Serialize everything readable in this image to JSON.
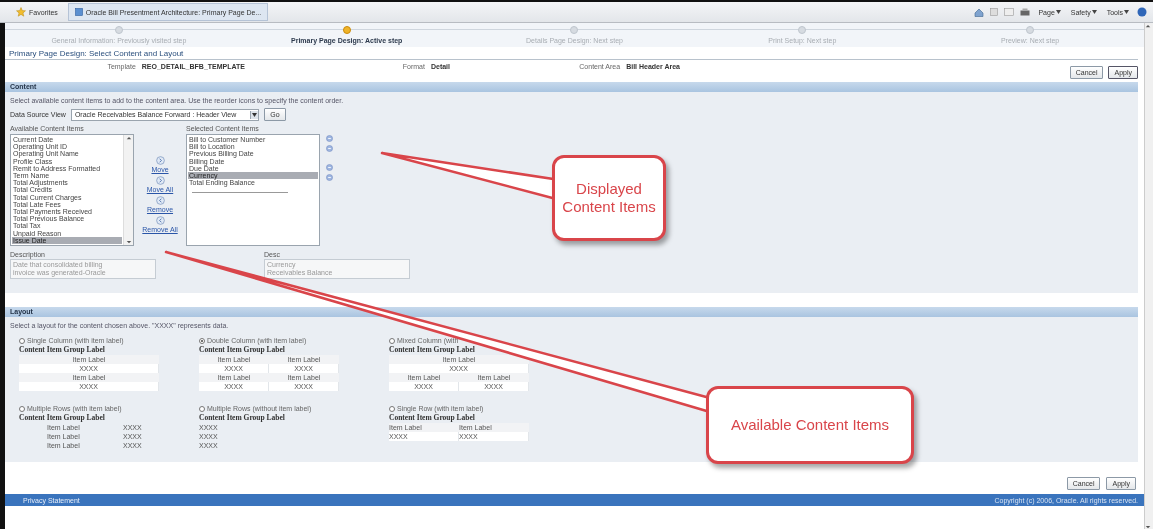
{
  "browser": {
    "favorites": "Favorites",
    "tab_title": "Oracle Bill Presentment Architecture: Primary Page De...",
    "commands": [
      "Page",
      "Safety",
      "Tools"
    ]
  },
  "train": [
    {
      "label": "General Information: Previously visited step",
      "selected": false
    },
    {
      "label": "Primary Page Design: Active step",
      "selected": true
    },
    {
      "label": "Details Page Design: Next step",
      "selected": false
    },
    {
      "label": "Print Setup: Next step",
      "selected": false
    },
    {
      "label": "Preview: Next step",
      "selected": false
    }
  ],
  "page_title": "Primary Page Design: Select Content and Layout",
  "info": [
    {
      "label": "Template",
      "value": "REO_DETAIL_BFB_TEMPLATE"
    },
    {
      "label": "Format",
      "value": "Detail"
    },
    {
      "label": "Content Area",
      "value": "Bill Header Area"
    }
  ],
  "top_buttons": [
    "Cancel",
    "Apply"
  ],
  "content": {
    "header": "Content",
    "instruction": "Select available content items to add to the content area. Use the reorder icons to specify the content order.",
    "data_source": {
      "label": "Data Source View",
      "value": "Oracle Receivables Balance Forward : Header View",
      "button": "Go"
    },
    "available": {
      "label": "Available Content Items",
      "items": [
        {
          "text": "Current Date",
          "selected": false
        },
        {
          "text": "Operating Unit ID",
          "selected": false
        },
        {
          "text": "Operating Unit Name",
          "selected": false
        },
        {
          "text": "Profile Class",
          "selected": false
        },
        {
          "text": "Remit to Address Formatted",
          "selected": false
        },
        {
          "text": "Term Name",
          "selected": false
        },
        {
          "text": "Total Adjustments",
          "selected": false
        },
        {
          "text": "Total Credits",
          "selected": false
        },
        {
          "text": "Total Current Charges",
          "selected": false
        },
        {
          "text": "Total Late Fees",
          "selected": false
        },
        {
          "text": "Total Payments Received",
          "selected": false
        },
        {
          "text": "Total Previous Balance",
          "selected": false
        },
        {
          "text": "Total Tax",
          "selected": false
        },
        {
          "text": "Unpaid Reason",
          "selected": false
        },
        {
          "text": "Issue Date",
          "selected": true
        }
      ]
    },
    "shuttle": [
      "Move",
      "Move All",
      "Remove",
      "Remove All"
    ],
    "selected": {
      "label": "Selected Content Items",
      "items": [
        {
          "text": "Bill to Customer Number",
          "selected": false
        },
        {
          "text": "Bill to Location",
          "selected": false
        },
        {
          "text": "Previous Billing Date",
          "selected": false
        },
        {
          "text": "Billing Date",
          "selected": false
        },
        {
          "text": "Due Date",
          "selected": false
        },
        {
          "text": "Currency",
          "selected": true
        },
        {
          "text": "Total Ending Balance",
          "selected": false
        }
      ]
    },
    "descriptions": [
      {
        "label": "Description",
        "lines": [
          "Date that consolidated billing",
          "invoice was generated-Oracle"
        ]
      },
      {
        "label": "Desc",
        "lines": [
          "Currency",
          "Receivables Balance"
        ]
      }
    ]
  },
  "layout": {
    "header": "Layout",
    "instruction": "Select a layout for the content chosen above. \"XXXX\" represents data.",
    "options": [
      {
        "label": "Single Column (with item label)",
        "selected": false,
        "group_label": "Content Item Group Label",
        "rows": [
          {
            "kind": "label",
            "cells": [
              "Item Label"
            ]
          },
          {
            "kind": "data",
            "cells": [
              "XXXX"
            ]
          },
          {
            "kind": "label",
            "cells": [
              "Item Label"
            ]
          },
          {
            "kind": "data",
            "cells": [
              "XXXX"
            ]
          }
        ]
      },
      {
        "label": "Double Column (with item label)",
        "selected": true,
        "group_label": "Content Item Group Label",
        "rows": [
          {
            "kind": "label",
            "cells": [
              "Item Label",
              "Item Label"
            ]
          },
          {
            "kind": "data",
            "cells": [
              "XXXX",
              "XXXX"
            ]
          },
          {
            "kind": "label",
            "cells": [
              "Item Label",
              "Item Label"
            ]
          },
          {
            "kind": "data",
            "cells": [
              "XXXX",
              "XXXX"
            ]
          }
        ]
      },
      {
        "label": "Mixed Column (with",
        "selected": false,
        "group_label": "Content Item Group Label",
        "rows": [
          {
            "kind": "label",
            "cells": [
              "Item Label"
            ]
          },
          {
            "kind": "data",
            "cells": [
              "XXXX"
            ]
          },
          {
            "kind": "label",
            "cells": [
              "Item Label",
              "Item Label"
            ]
          },
          {
            "kind": "data",
            "cells": [
              "XXXX",
              "XXXX"
            ]
          }
        ]
      },
      {
        "label": "Multiple Rows (with item label)",
        "selected": false,
        "group_label": "Content Item Group Label",
        "rows": [
          {
            "kind": "pair",
            "cells": [
              "Item Label",
              "XXXX"
            ]
          },
          {
            "kind": "pair",
            "cells": [
              "Item Label",
              "XXXX"
            ]
          },
          {
            "kind": "pair",
            "cells": [
              "Item Label",
              "XXXX"
            ]
          }
        ]
      },
      {
        "label": "Multiple Rows (without item label)",
        "selected": false,
        "group_label": "Content Item Group Label",
        "rows": [
          {
            "kind": "plain",
            "cells": [
              "XXXX"
            ]
          },
          {
            "kind": "plain",
            "cells": [
              "XXXX"
            ]
          },
          {
            "kind": "plain",
            "cells": [
              "XXXX"
            ]
          }
        ]
      },
      {
        "label": "Single Row (with item label)",
        "selected": false,
        "group_label": "Content Item Group Label",
        "rows": [
          {
            "kind": "label",
            "cells": [
              "Item Label",
              "Item Label"
            ]
          },
          {
            "kind": "data",
            "cells": [
              "XXXX",
              "XXXX"
            ]
          }
        ]
      }
    ]
  },
  "bottom_buttons": [
    "Cancel",
    "Apply"
  ],
  "footer": {
    "link": "Privacy Statement",
    "copyright": "Copyright (c) 2006, Oracle. All rights reserved."
  },
  "callouts": [
    {
      "text": "Displayed Content Items"
    },
    {
      "text": "Available Content Items"
    }
  ]
}
